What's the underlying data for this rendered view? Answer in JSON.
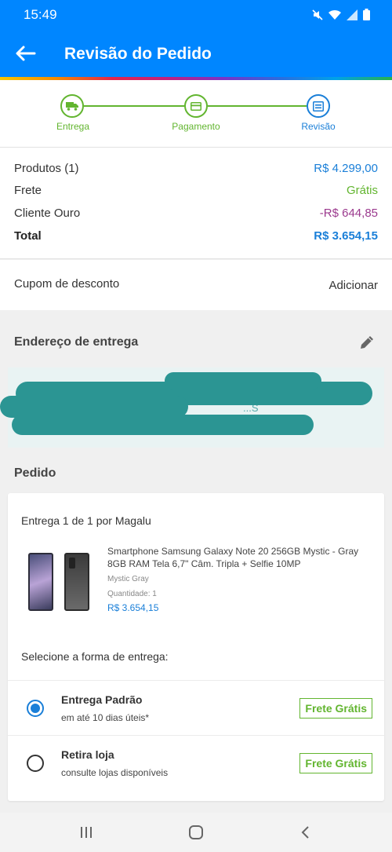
{
  "status_bar": {
    "time": "15:49",
    "icons": [
      "mute-icon",
      "wifi-icon",
      "signal-icon",
      "battery-icon"
    ]
  },
  "app_bar": {
    "title": "Revisão do Pedido",
    "back_icon": "arrow-left-icon",
    "color": "#0086ff"
  },
  "steps": [
    {
      "label": "Entrega",
      "icon": "truck-icon",
      "state": "done"
    },
    {
      "label": "Pagamento",
      "icon": "card-icon",
      "state": "done"
    },
    {
      "label": "Revisão",
      "icon": "receipt-icon",
      "state": "active"
    }
  ],
  "summary": {
    "rows": [
      {
        "label": "Produtos (1)",
        "value": "R$ 4.299,00"
      },
      {
        "label": "Frete",
        "value": "Grátis"
      },
      {
        "label": "Cliente Ouro",
        "value": "-R$ 644,85"
      },
      {
        "label": "Total",
        "value": "R$ 3.654,15"
      }
    ]
  },
  "coupon": {
    "label": "Cupom de desconto",
    "action": "Adicionar"
  },
  "address": {
    "title": "Endereço de entrega",
    "edit_icon": "pencil-icon",
    "visible_fragment": "...S"
  },
  "order": {
    "title": "Pedido",
    "delivery_title": "Entrega 1 de 1 por Magalu",
    "product": {
      "name": "Smartphone Samsung Galaxy Note 20 256GB Mystic - Gray 8GB RAM Tela 6,7\" Câm. Tripla + Selfie 10MP",
      "color": "Mystic Gray",
      "quantity": "Quantidade: 1",
      "price": "R$ 3.654,15"
    },
    "select_label": "Selecione a forma de entrega:",
    "shipping_options": [
      {
        "name": "Entrega Padrão",
        "desc": "em até 10 dias úteis*",
        "badge": "Frete Grátis",
        "selected": true
      },
      {
        "name": "Retira loja",
        "desc": "consulte lojas disponíveis",
        "badge": "Frete Grátis",
        "selected": false
      }
    ]
  },
  "nav_bar": {
    "icons": [
      "recent-apps-icon",
      "home-icon",
      "back-icon"
    ]
  },
  "colors": {
    "primary_blue": "#0086ff",
    "link_blue": "#1a7fd8",
    "green": "#62b52f",
    "purple": "#9b3a8e",
    "redaction": "#2b9593"
  }
}
